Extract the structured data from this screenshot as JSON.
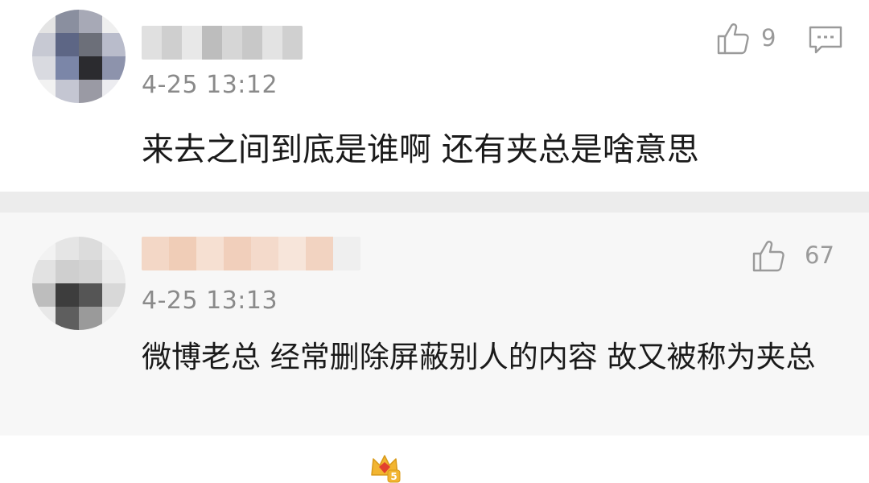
{
  "comments": [
    {
      "timestamp": "4-25 13:12",
      "text": "来去之间到底是谁啊 还有夹总是啥意思",
      "likes": "9",
      "reply_icon": "comment-reply-icon",
      "like_icon": "thumbs-up-icon"
    },
    {
      "timestamp": "4-25 13:13",
      "text": "微博老总 经常删除屏蔽别人的内容 故又被称为夹总",
      "likes": "67",
      "like_icon": "thumbs-up-icon",
      "badge": {
        "icon": "crown-level-badge-icon",
        "level": "5"
      }
    }
  ],
  "colors": {
    "secondary_text": "#8a8a8a",
    "icon_stroke": "#9a9a9a",
    "badge_gold": "#f2b531",
    "badge_red": "#e2412f"
  }
}
